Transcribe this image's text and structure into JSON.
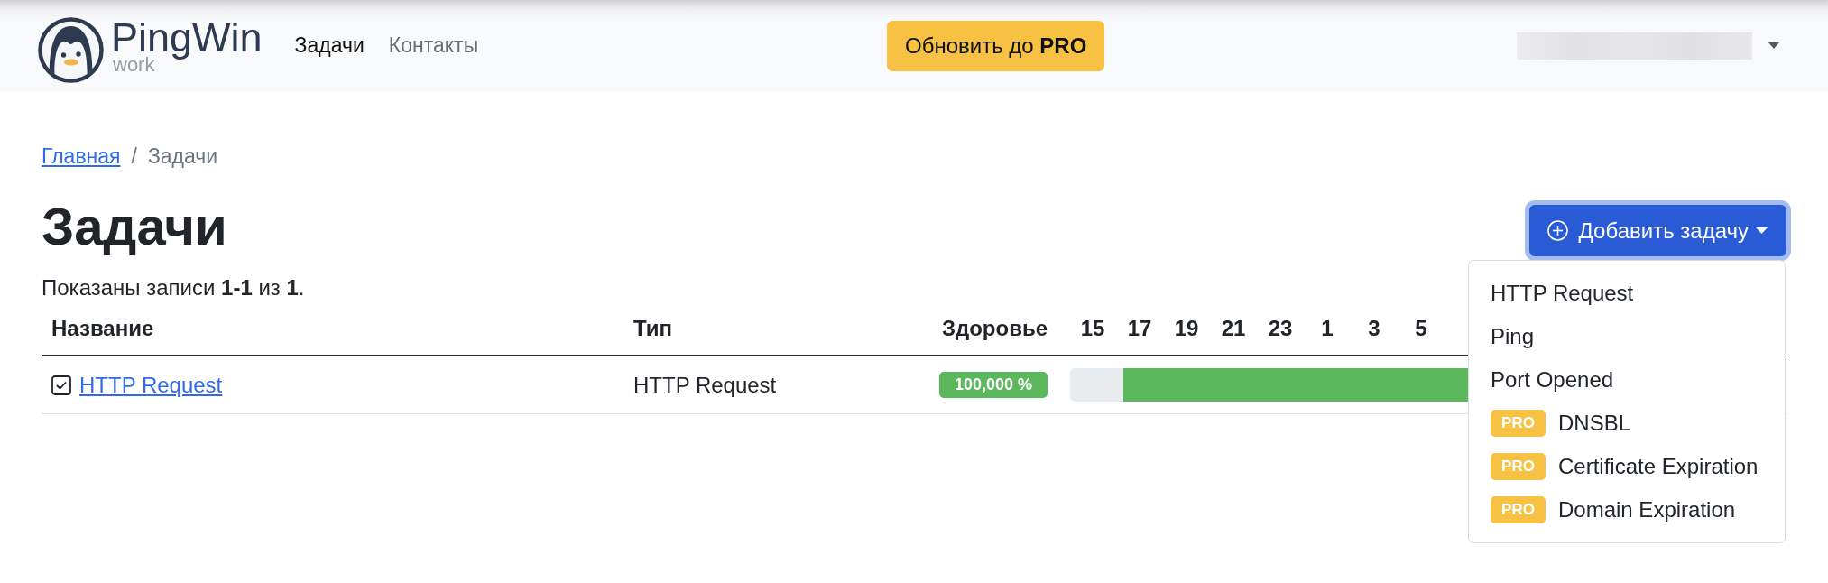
{
  "header": {
    "brand": {
      "name": "PingWin",
      "tagline": "work"
    },
    "nav": [
      {
        "label": "Задачи",
        "selected": true
      },
      {
        "label": "Контакты",
        "selected": false
      }
    ],
    "upgrade_button": "Обновить до **PRO**"
  },
  "breadcrumb": {
    "items": [
      {
        "label": "Главная",
        "kind": "link"
      },
      {
        "label": "Задачи",
        "kind": "current"
      }
    ],
    "separator": "/"
  },
  "page": {
    "title": "Задачи",
    "summary": "Показаны записи **1-1** из **1**."
  },
  "add_button": {
    "label": "Добавить задачу",
    "expanded": true
  },
  "add_menu": [
    {
      "label": "HTTP Request"
    },
    {
      "label": "Ping"
    },
    {
      "label": "Port Opened"
    },
    {
      "label": "DNSBL",
      "badge": "PRO"
    },
    {
      "label": "Certificate Expiration",
      "badge": "PRO"
    },
    {
      "label": "Domain Expiration",
      "badge": "PRO"
    }
  ],
  "table": {
    "columns": [
      "Название",
      "Тип",
      "Здоровье"
    ],
    "hours": [
      "15",
      "17",
      "19",
      "21",
      "23",
      "1",
      "3",
      "5"
    ],
    "rows": [
      {
        "name": "HTTP Request",
        "type": "HTTP Request",
        "health": "100,000 %",
        "uptime_bar": {
          "level": 0.925
        }
      }
    ]
  }
}
